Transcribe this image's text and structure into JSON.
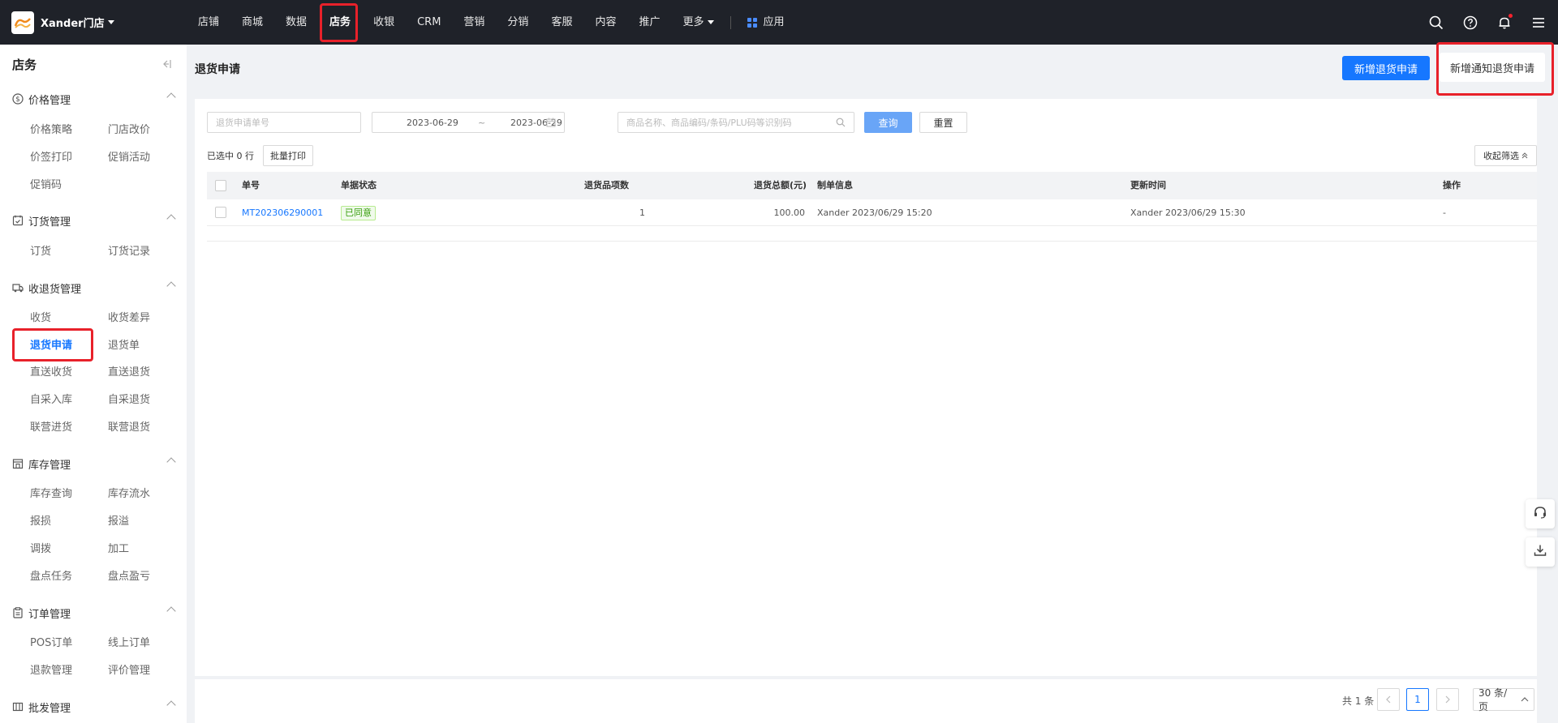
{
  "header": {
    "store_name": "Xander门店",
    "nav": [
      "店铺",
      "商城",
      "数据",
      "店务",
      "收银",
      "CRM",
      "营销",
      "分销",
      "客服",
      "内容",
      "推广"
    ],
    "more_label": "更多",
    "apps_label": "应用",
    "active_nav": "店务"
  },
  "sidebar": {
    "title": "店务",
    "groups": [
      {
        "title": "价格管理",
        "icon": "dollar-circle-icon",
        "items": [
          "价格策略",
          "门店改价",
          "价签打印",
          "促销活动",
          "促销码"
        ]
      },
      {
        "title": "订货管理",
        "icon": "order-calendar-icon",
        "items": [
          "订货",
          "订货记录"
        ]
      },
      {
        "title": "收退货管理",
        "icon": "truck-icon",
        "items": [
          "收货",
          "收货差异",
          "退货申请",
          "退货单",
          "直送收货",
          "直送退货",
          "自采入库",
          "自采退货",
          "联营进货",
          "联营退货"
        ]
      },
      {
        "title": "库存管理",
        "icon": "warehouse-icon",
        "items": [
          "库存查询",
          "库存流水",
          "报损",
          "报溢",
          "调拨",
          "加工",
          "盘点任务",
          "盘点盈亏"
        ]
      },
      {
        "title": "订单管理",
        "icon": "clipboard-icon",
        "items": [
          "POS订单",
          "线上订单",
          "退款管理",
          "评价管理"
        ]
      },
      {
        "title": "批发管理",
        "icon": "wholesale-icon",
        "items": []
      }
    ],
    "active_item": "退货申请"
  },
  "page": {
    "title": "退货申请",
    "new_button": "新增退货申请",
    "new_notify_button": "新增通知退货申请"
  },
  "filters": {
    "order_no_placeholder": "退货申请单号",
    "date_start": "2023-06-29",
    "date_sep": "~",
    "date_end": "2023-06-29",
    "product_placeholder": "商品名称、商品编码/条码/PLU码等识别码",
    "query_button": "查询",
    "reset_button": "重置",
    "selected_text": "已选中 0 行",
    "batch_print_button": "批量打印",
    "collapse_filter_button": "收起筛选"
  },
  "table": {
    "columns": [
      "单号",
      "单据状态",
      "退货品项数",
      "退货总额(元)",
      "制单信息",
      "更新时间",
      "操作"
    ],
    "rows": [
      {
        "order_no": "MT202306290001",
        "status": "已同意",
        "item_count": "1",
        "total": "100.00",
        "creator": "Xander 2023/06/29 15:20",
        "updated": "Xander 2023/06/29 15:30",
        "action": "-"
      }
    ]
  },
  "pagination": {
    "total_text": "共 1 条",
    "current_page": "1",
    "page_size": "30 条/页"
  },
  "colors": {
    "primary": "#1677ff",
    "topbar": "#1f2229",
    "highlight": "#e8212a"
  }
}
